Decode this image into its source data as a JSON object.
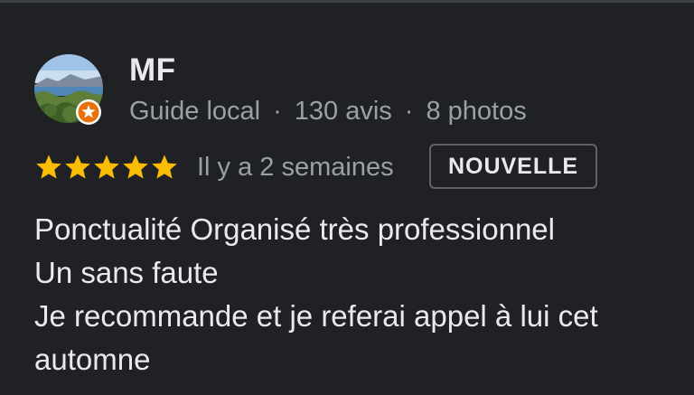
{
  "review": {
    "author_name": "MF",
    "author_meta": {
      "level": "Guide local",
      "reviews": "130 avis",
      "photos": "8 photos",
      "separator": "·"
    },
    "rating": 5,
    "date": "Il y a 2 semaines",
    "badge": "NOUVELLE",
    "text_lines": [
      "Ponctualité Organisé très professionnel",
      "Un sans faute",
      "Je recommande et je referai appel à lui cet",
      "automne"
    ]
  },
  "colors": {
    "background": "#202124",
    "star": "#fbbc04",
    "guide_badge": "#e8710a"
  },
  "icons": {
    "avatar": "landscape-photo-avatar",
    "guide_badge": "local-guide-badge-icon",
    "star": "star-icon"
  }
}
